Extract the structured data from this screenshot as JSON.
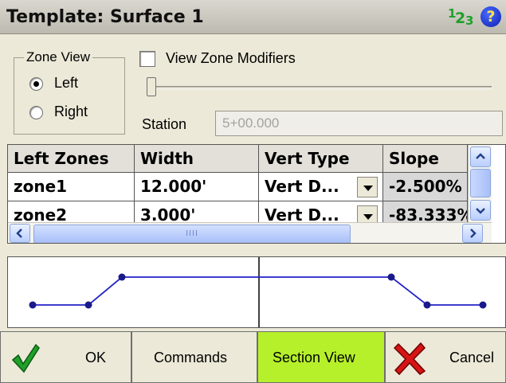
{
  "window": {
    "title": "Template: Surface 1"
  },
  "header_icons": {
    "numeric": [
      "1",
      "2",
      "3"
    ],
    "help": "?"
  },
  "zone_view": {
    "label": "Zone View",
    "options": [
      {
        "label": "Left",
        "selected": true
      },
      {
        "label": "Right",
        "selected": false
      }
    ]
  },
  "view_zone_modifiers": {
    "label": "View Zone Modifiers",
    "checked": false
  },
  "station": {
    "label": "Station",
    "value": "5+00.000"
  },
  "grid": {
    "headers": [
      "Left Zones",
      "Width",
      "Vert Type",
      "Slope"
    ],
    "rows": [
      [
        "zone1",
        "12.000'",
        "Vert D...",
        "-2.500%"
      ],
      [
        "zone2",
        "3.000'",
        "Vert D...",
        "-83.333%"
      ]
    ],
    "hscroll_grip": "IIII"
  },
  "buttons": {
    "ok": "OK",
    "commands": "Commands",
    "section_view": "Section View",
    "cancel": "Cancel"
  },
  "colors": {
    "accent_button": "#b6f02a",
    "profile_line": "#2323c8"
  }
}
